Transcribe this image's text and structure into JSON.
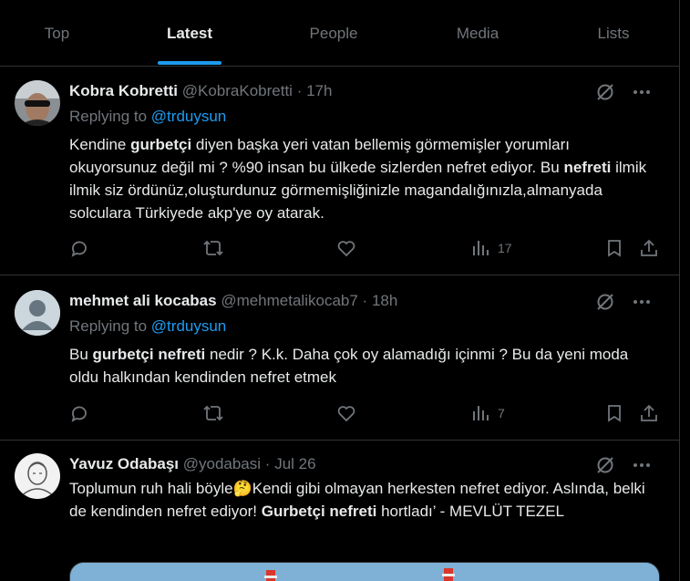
{
  "tabs": [
    {
      "label": "Top",
      "active": false
    },
    {
      "label": "Latest",
      "active": true
    },
    {
      "label": "People",
      "active": false
    },
    {
      "label": "Media",
      "active": false
    },
    {
      "label": "Lists",
      "active": false
    }
  ],
  "tweets": [
    {
      "name": "Kobra Kobretti",
      "handle": "@KobraKobretti",
      "dot": "·",
      "time": "17h",
      "replying_prefix": "Replying to",
      "replying_to": "@trduysun",
      "text_parts": [
        "Kendine ",
        "gurbetçi",
        " diyen başka yeri vatan bellemiş görmemişler yorumları okuyorsunuz değil mi ? %90 insan bu ülkede sizlerden nefret ediyor. Bu ",
        "nefreti",
        " ilmik ilmik siz ördünüz,oluşturdunuz görmemişliğinizle magandalığınızla,almanyada solculara Türkiyede akp'ye oy atarak."
      ],
      "views": "17"
    },
    {
      "name": "mehmet ali kocabas",
      "handle": "@mehmetalikocab7",
      "dot": "·",
      "time": "18h",
      "replying_prefix": "Replying to",
      "replying_to": "@trduysun",
      "text_parts": [
        "Bu ",
        "gurbetçi nefreti",
        " nedir ? K.k. Daha çok oy alamadığı içinmi ? Bu da yeni moda oldu halkından kendinden nefret etmek"
      ],
      "views": "7"
    },
    {
      "name": "Yavuz Odabaşı",
      "handle": "@yodabasi",
      "dot": "·",
      "time": "Jul 26",
      "text_parts": [
        "Toplumun ruh hali böyle",
        "🤔",
        "Kendi gibi olmayan herkesten nefret ediyor. Aslında, belki de kendinden nefret ediyor! ",
        "Gurbetçi nefreti",
        " hortladı’ - MEVLÜT TEZEL"
      ]
    }
  ],
  "icons": {
    "grok": "grok-icon",
    "more": "more-icon",
    "reply": "reply-icon",
    "repost": "repost-icon",
    "like": "like-icon",
    "views": "views-icon",
    "bookmark": "bookmark-icon",
    "share": "share-icon"
  },
  "colors": {
    "accent": "#1d9bf0",
    "text": "#e7e9ea",
    "muted": "#71767b",
    "border": "#2f3336",
    "background": "#000000"
  }
}
